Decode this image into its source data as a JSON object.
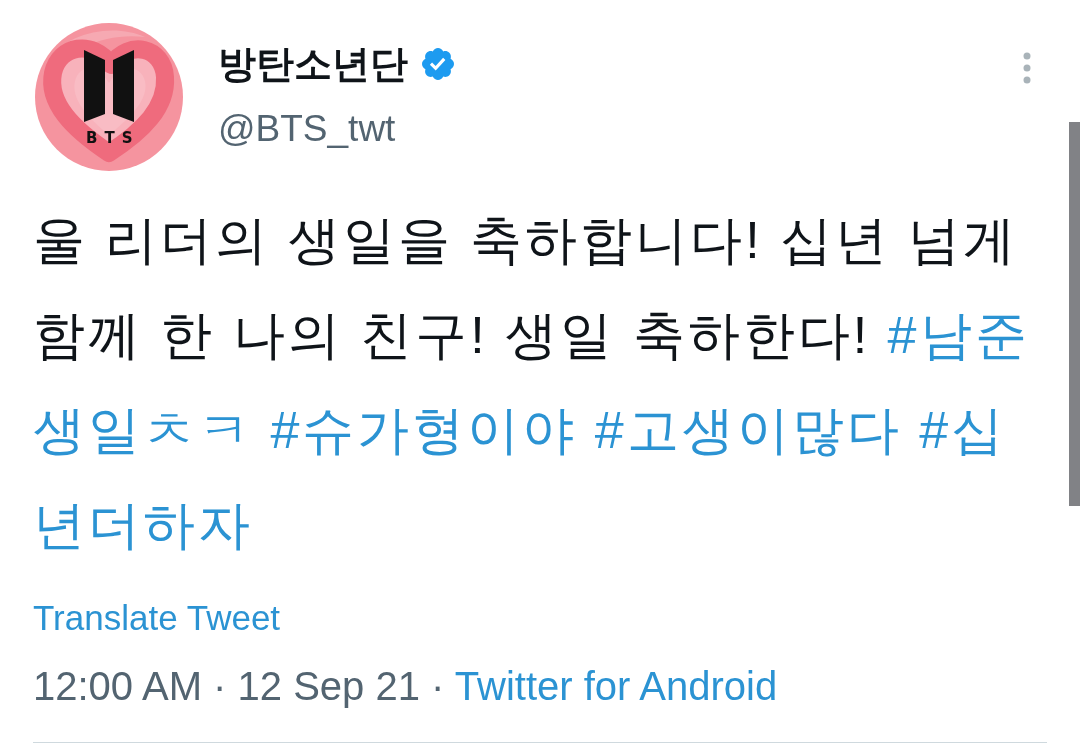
{
  "tweet": {
    "author": {
      "avatar": {
        "logo_text": "BTS"
      },
      "name": "방탄소년단",
      "verified": true,
      "handle": "@BTS_twt"
    },
    "lines": [
      [
        {
          "kind": "text",
          "text": "울 리더의 생일을 축하합니다! 십년 넘게"
        }
      ],
      [
        {
          "kind": "text",
          "text": "함께 한 나의 친구! 생일 축하한다!"
        },
        {
          "kind": "hashtag",
          "text": "#남준"
        }
      ],
      [
        {
          "kind": "hashtag",
          "text": "생일ㅊㅋ"
        },
        {
          "kind": "hashtag",
          "text": "#슈가형이야"
        },
        {
          "kind": "hashtag",
          "text": "#고생이많다"
        },
        {
          "kind": "hashtag",
          "text": "#십"
        }
      ],
      [
        {
          "kind": "hashtag",
          "text": "년더하자"
        }
      ]
    ],
    "translate_link": "Translate Tweet",
    "timestamp": "12:00 AM · 12 Sep 21 ·",
    "source": "Twitter for Android"
  }
}
